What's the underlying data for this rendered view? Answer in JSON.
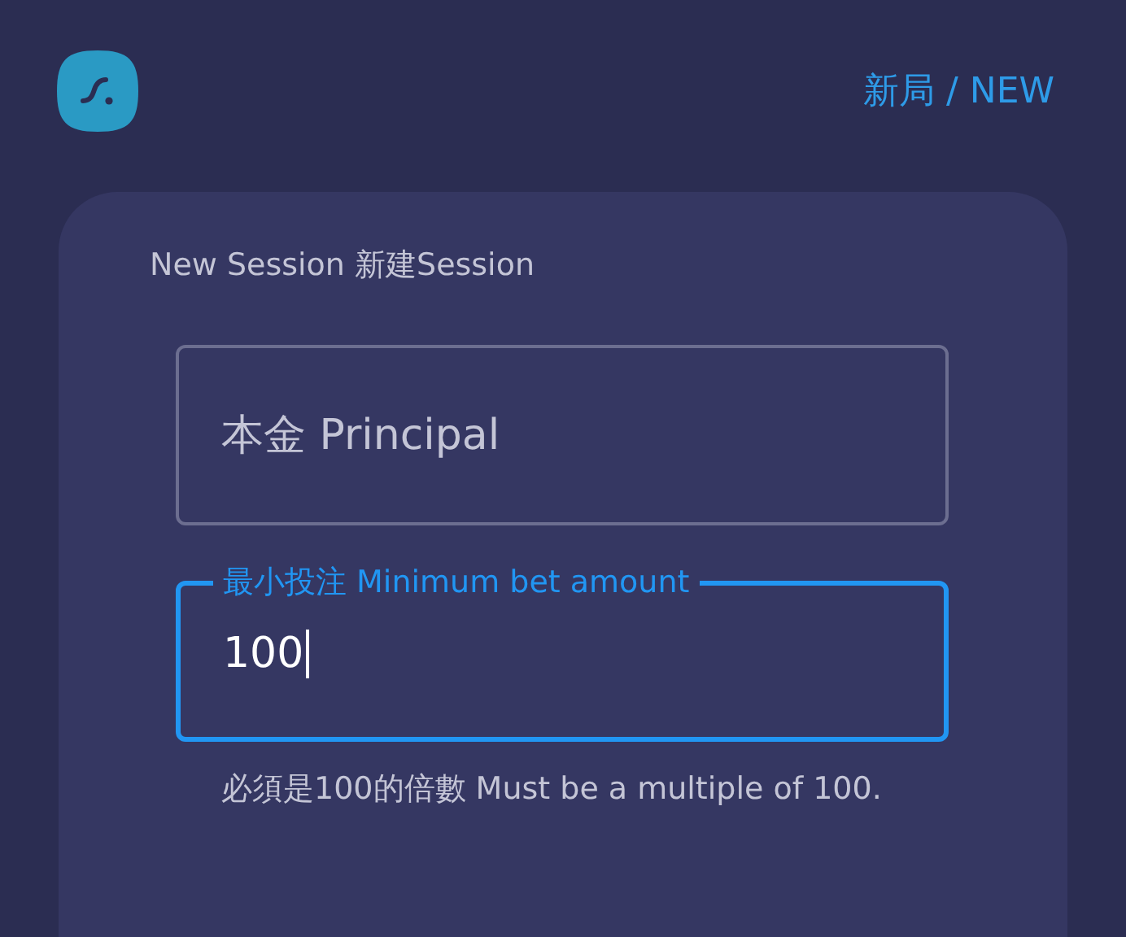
{
  "header": {
    "title": "新局 / NEW"
  },
  "card": {
    "title": "New Session 新建Session"
  },
  "fields": [
    {
      "placeholder": "本金 Principal",
      "focused": false
    },
    {
      "label": "最小投注 Minimum bet amount",
      "value": "100",
      "focused": true,
      "helper": "必須是100的倍數 Must be a multiple of 100."
    }
  ]
}
